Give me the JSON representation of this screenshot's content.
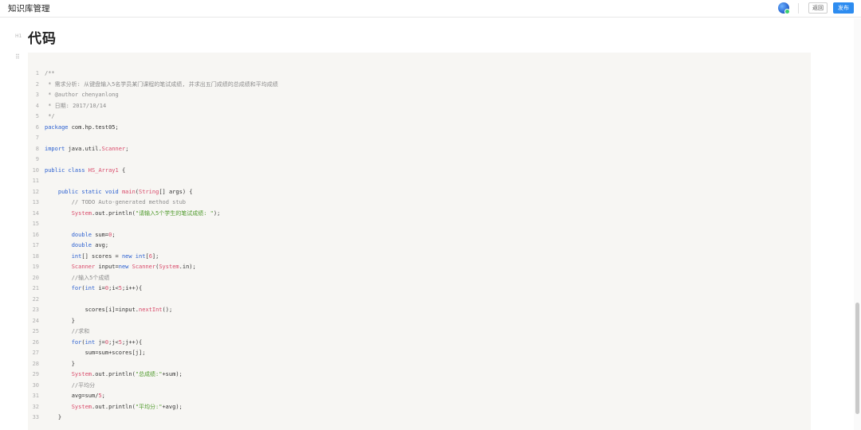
{
  "header": {
    "title": "知识库管理",
    "back_label": "返回",
    "publish_label": "发布"
  },
  "section": {
    "heading_marker": "H1",
    "heading": "代码",
    "drag_marker": "⠿"
  },
  "code": {
    "lines": [
      [
        [
          "c-comment",
          "/**"
        ]
      ],
      [
        [
          "c-comment",
          " * 需求分析: 从键盘输入5名学员某门课程的笔试成绩, 并求出五门成绩的总成绩和平均成绩"
        ]
      ],
      [
        [
          "c-comment",
          " * @author chenyanlong"
        ]
      ],
      [
        [
          "c-comment",
          " * 日期: 2017/10/14"
        ]
      ],
      [
        [
          "c-comment",
          " */"
        ]
      ],
      [
        [
          "c-kw",
          "package "
        ],
        [
          "c-plain",
          "com.hp.test05;"
        ]
      ],
      [],
      [
        [
          "c-kw",
          "import "
        ],
        [
          "c-plain",
          "java.util."
        ],
        [
          "c-cls",
          "Scanner"
        ],
        [
          "c-plain",
          ";"
        ]
      ],
      [],
      [
        [
          "c-kw",
          "public class "
        ],
        [
          "c-cls",
          "HS_Array1"
        ],
        [
          "c-plain",
          " {"
        ]
      ],
      [],
      [
        [
          "c-plain",
          "    "
        ],
        [
          "c-kw",
          "public static void "
        ],
        [
          "c-cls",
          "main"
        ],
        [
          "c-plain",
          "("
        ],
        [
          "c-cls",
          "String"
        ],
        [
          "c-plain",
          "[] args) {"
        ]
      ],
      [
        [
          "c-plain",
          "        "
        ],
        [
          "c-comment",
          "// TODO Auto-generated method stub"
        ]
      ],
      [
        [
          "c-plain",
          "        "
        ],
        [
          "c-cls",
          "System"
        ],
        [
          "c-plain",
          ".out.println("
        ],
        [
          "c-str",
          "\"请输入5个学生的笔试成绩: \""
        ],
        [
          "c-plain",
          ");"
        ]
      ],
      [],
      [
        [
          "c-plain",
          "        "
        ],
        [
          "c-kw",
          "double "
        ],
        [
          "c-plain",
          "sum="
        ],
        [
          "c-num",
          "0"
        ],
        [
          "c-plain",
          ";"
        ]
      ],
      [
        [
          "c-plain",
          "        "
        ],
        [
          "c-kw",
          "double "
        ],
        [
          "c-plain",
          "avg;"
        ]
      ],
      [
        [
          "c-plain",
          "        "
        ],
        [
          "c-kw",
          "int"
        ],
        [
          "c-plain",
          "[] scores = "
        ],
        [
          "c-kw",
          "new int"
        ],
        [
          "c-plain",
          "["
        ],
        [
          "c-num",
          "6"
        ],
        [
          "c-plain",
          "];"
        ]
      ],
      [
        [
          "c-plain",
          "        "
        ],
        [
          "c-cls",
          "Scanner"
        ],
        [
          "c-plain",
          " input="
        ],
        [
          "c-kw",
          "new "
        ],
        [
          "c-cls",
          "Scanner"
        ],
        [
          "c-plain",
          "("
        ],
        [
          "c-cls",
          "System"
        ],
        [
          "c-plain",
          ".in);"
        ]
      ],
      [
        [
          "c-plain",
          "        "
        ],
        [
          "c-comment",
          "//输入5个成绩"
        ]
      ],
      [
        [
          "c-plain",
          "        "
        ],
        [
          "c-kw",
          "for"
        ],
        [
          "c-plain",
          "("
        ],
        [
          "c-kw",
          "int "
        ],
        [
          "c-plain",
          "i="
        ],
        [
          "c-num",
          "0"
        ],
        [
          "c-plain",
          ";i<"
        ],
        [
          "c-num",
          "5"
        ],
        [
          "c-plain",
          ";i++){"
        ]
      ],
      [],
      [
        [
          "c-plain",
          "            scores[i]=input."
        ],
        [
          "c-cls",
          "nextInt"
        ],
        [
          "c-plain",
          "();"
        ]
      ],
      [
        [
          "c-plain",
          "        }"
        ]
      ],
      [
        [
          "c-plain",
          "        "
        ],
        [
          "c-comment",
          "//求和"
        ]
      ],
      [
        [
          "c-plain",
          "        "
        ],
        [
          "c-kw",
          "for"
        ],
        [
          "c-plain",
          "("
        ],
        [
          "c-kw",
          "int "
        ],
        [
          "c-plain",
          "j="
        ],
        [
          "c-num",
          "0"
        ],
        [
          "c-plain",
          ";j<"
        ],
        [
          "c-num",
          "5"
        ],
        [
          "c-plain",
          ";j++){"
        ]
      ],
      [
        [
          "c-plain",
          "            sum=sum+scores[j];"
        ]
      ],
      [
        [
          "c-plain",
          "        }"
        ]
      ],
      [
        [
          "c-plain",
          "        "
        ],
        [
          "c-cls",
          "System"
        ],
        [
          "c-plain",
          ".out.println("
        ],
        [
          "c-str",
          "\"总成绩:\""
        ],
        [
          "c-plain",
          "+sum);"
        ]
      ],
      [
        [
          "c-plain",
          "        "
        ],
        [
          "c-comment",
          "//平均分"
        ]
      ],
      [
        [
          "c-plain",
          "        avg=sum/"
        ],
        [
          "c-num",
          "5"
        ],
        [
          "c-plain",
          ";"
        ]
      ],
      [
        [
          "c-plain",
          "        "
        ],
        [
          "c-cls",
          "System"
        ],
        [
          "c-plain",
          ".out.println("
        ],
        [
          "c-str",
          "\"平均分:\""
        ],
        [
          "c-plain",
          "+avg);"
        ]
      ],
      [
        [
          "c-plain",
          "    }"
        ]
      ]
    ]
  }
}
